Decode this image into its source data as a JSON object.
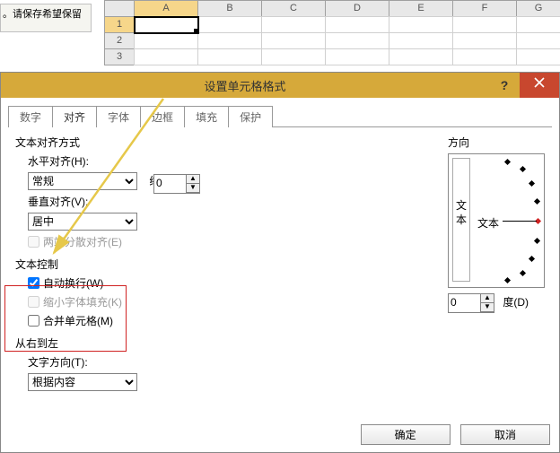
{
  "sheet": {
    "note_text": "。请保存希望保留",
    "cols": [
      "A",
      "B",
      "C",
      "D",
      "E",
      "F",
      "G"
    ],
    "rows": [
      "1",
      "2",
      "3"
    ]
  },
  "dialog": {
    "title": "设置单元格格式",
    "tabs": [
      "数字",
      "对齐",
      "字体",
      "边框",
      "填充",
      "保护"
    ],
    "active_tab": 1,
    "align": {
      "section_label": "文本对齐方式",
      "h_label": "水平对齐(H):",
      "h_value": "常规",
      "indent_label": "缩进(I):",
      "indent_value": "0",
      "v_label": "垂直对齐(V):",
      "v_value": "居中",
      "justify_distributed": "两端分散对齐(E)"
    },
    "control": {
      "section_label": "文本控制",
      "wrap": "自动换行(W)",
      "shrink": "缩小字体填充(K)",
      "merge": "合并单元格(M)"
    },
    "rtl": {
      "section_label": "从右到左",
      "dir_label": "文字方向(T):",
      "dir_value": "根据内容"
    },
    "orient": {
      "section_label": "方向",
      "vtext_a": "文",
      "vtext_b": "本",
      "htext": "文本",
      "deg_value": "0",
      "deg_label": "度(D)"
    },
    "buttons": {
      "ok": "确定",
      "cancel": "取消"
    }
  }
}
